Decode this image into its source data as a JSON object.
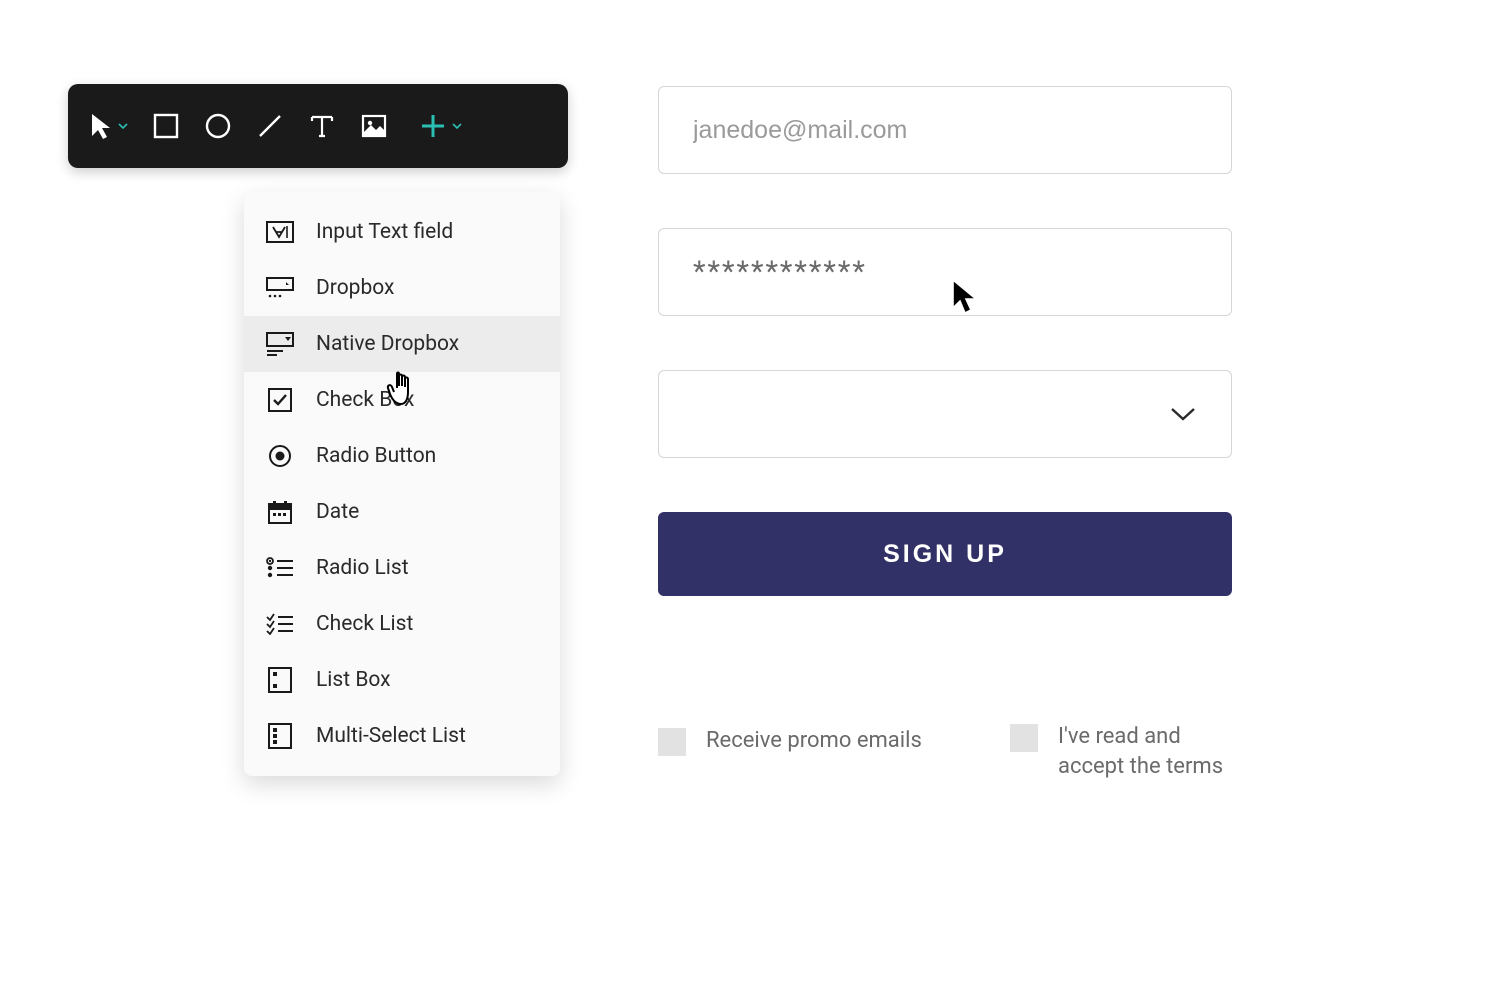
{
  "toolbar": {
    "tools": [
      {
        "name": "pointer",
        "has_dropdown": true
      },
      {
        "name": "rectangle",
        "has_dropdown": false
      },
      {
        "name": "circle",
        "has_dropdown": false
      },
      {
        "name": "line",
        "has_dropdown": false
      },
      {
        "name": "text",
        "has_dropdown": false
      },
      {
        "name": "image",
        "has_dropdown": false
      },
      {
        "name": "add",
        "has_dropdown": true,
        "color": "#2bbfb3"
      }
    ]
  },
  "dropdown": {
    "items": [
      {
        "label": "Input Text field",
        "icon": "input-text"
      },
      {
        "label": "Dropbox",
        "icon": "dropbox"
      },
      {
        "label": "Native Dropbox",
        "icon": "native-dropbox",
        "hovered": true
      },
      {
        "label": "Check Box",
        "icon": "checkbox"
      },
      {
        "label": "Radio Button",
        "icon": "radio"
      },
      {
        "label": "Date",
        "icon": "date"
      },
      {
        "label": "Radio List",
        "icon": "radio-list"
      },
      {
        "label": "Check List",
        "icon": "check-list"
      },
      {
        "label": "List Box",
        "icon": "list-box"
      },
      {
        "label": "Multi-Select List",
        "icon": "multi-select"
      }
    ]
  },
  "form": {
    "email_placeholder": "janedoe@mail.com",
    "password_value": "************",
    "select_value": "",
    "signup_label": "SIGN UP",
    "checkbox1_label": "Receive promo emails",
    "checkbox2_label": "I've read and accept the terms"
  },
  "colors": {
    "accent": "#2bbfb3",
    "button_bg": "#323167"
  }
}
